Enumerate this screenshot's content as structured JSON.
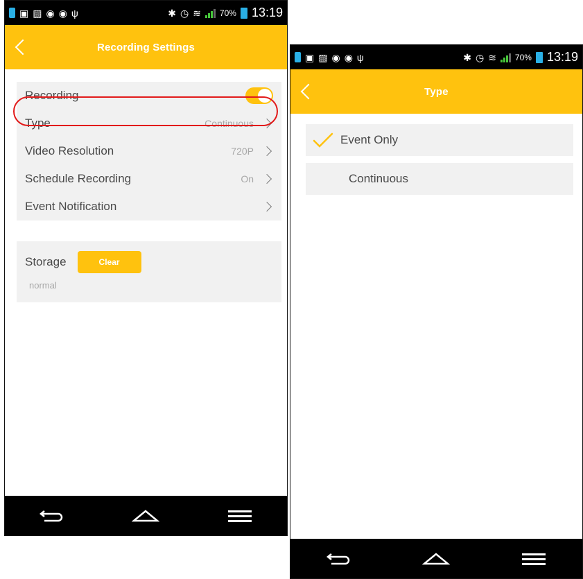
{
  "status_bar": {
    "battery_percent": "70%",
    "time": "13:19",
    "icons": [
      "battery-charging-icon",
      "image-icon",
      "photo-icon",
      "shield-icon",
      "shield-icon",
      "usb-icon",
      "bluetooth-icon",
      "alarm-icon",
      "wifi-icon",
      "signal-icon"
    ]
  },
  "screen1": {
    "title": "Recording Settings",
    "rows": [
      {
        "label": "Recording",
        "value": "",
        "toggle": true
      },
      {
        "label": "Type",
        "value": "Continuous"
      },
      {
        "label": "Video Resolution",
        "value": "720P"
      },
      {
        "label": "Schedule Recording",
        "value": "On"
      },
      {
        "label": "Event Notification",
        "value": ""
      }
    ],
    "storage": {
      "label": "Storage",
      "button": "Clear",
      "status": "normal"
    }
  },
  "screen2": {
    "title": "Type",
    "options": [
      {
        "label": "Event Only",
        "selected": true
      },
      {
        "label": "Continuous",
        "selected": false
      }
    ]
  },
  "colors": {
    "accent": "#ffc20e",
    "highlight": "#e21a1a",
    "card": "#f1f1f1"
  }
}
